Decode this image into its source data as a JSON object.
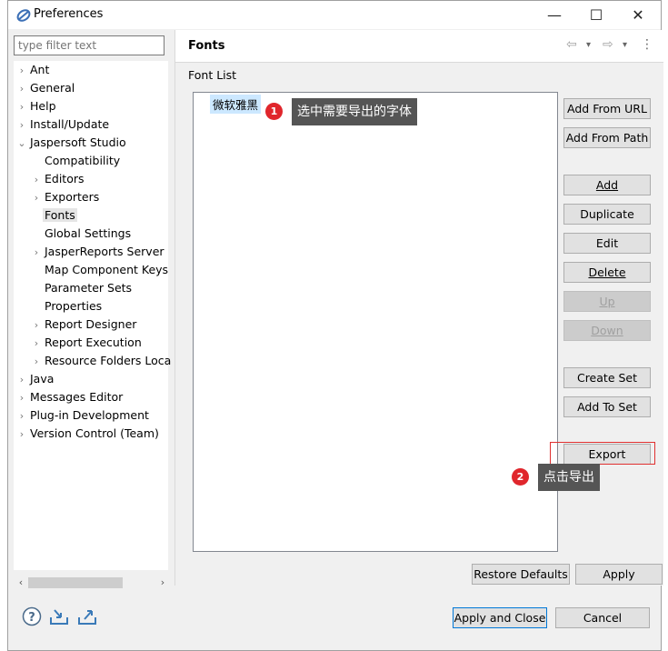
{
  "window": {
    "title": "Preferences",
    "controls": {
      "minimize": "—",
      "maximize": "☐",
      "close": "✕"
    }
  },
  "sidebar": {
    "filter_placeholder": "type filter text",
    "items": [
      {
        "label": "Ant",
        "level": 0,
        "expander": "›"
      },
      {
        "label": "General",
        "level": 0,
        "expander": "›"
      },
      {
        "label": "Help",
        "level": 0,
        "expander": "›"
      },
      {
        "label": "Install/Update",
        "level": 0,
        "expander": "›"
      },
      {
        "label": "Jaspersoft Studio",
        "level": 0,
        "expander": "⌄"
      },
      {
        "label": "Compatibility",
        "level": 1,
        "expander": ""
      },
      {
        "label": "Editors",
        "level": 1,
        "expander": "›"
      },
      {
        "label": "Exporters",
        "level": 1,
        "expander": "›"
      },
      {
        "label": "Fonts",
        "level": 1,
        "expander": "",
        "selected": true
      },
      {
        "label": "Global Settings",
        "level": 1,
        "expander": ""
      },
      {
        "label": "JasperReports Server",
        "level": 1,
        "expander": "›"
      },
      {
        "label": "Map Component Keys",
        "level": 1,
        "expander": ""
      },
      {
        "label": "Parameter Sets",
        "level": 1,
        "expander": ""
      },
      {
        "label": "Properties",
        "level": 1,
        "expander": ""
      },
      {
        "label": "Report Designer",
        "level": 1,
        "expander": "›"
      },
      {
        "label": "Report Execution",
        "level": 1,
        "expander": "›"
      },
      {
        "label": "Resource Folders Loca",
        "level": 1,
        "expander": "›"
      },
      {
        "label": "Java",
        "level": 0,
        "expander": "›"
      },
      {
        "label": "Messages Editor",
        "level": 0,
        "expander": "›"
      },
      {
        "label": "Plug-in Development",
        "level": 0,
        "expander": "›"
      },
      {
        "label": "Version Control (Team)",
        "level": 0,
        "expander": "›"
      }
    ],
    "scroll_left": "‹",
    "scroll_right": "›"
  },
  "page": {
    "title": "Fonts",
    "nav": {
      "back": "⇦",
      "back_menu": "▾",
      "forward": "⇨",
      "forward_menu": "▾",
      "more": "⋮"
    },
    "font_list_label": "Font List",
    "fonts": [
      "微软雅黑"
    ],
    "buttons": {
      "add_from_url": "Add From URL",
      "add_from_path": "Add From Path",
      "add": "Add",
      "duplicate": "Duplicate",
      "edit": "Edit",
      "delete": "Delete",
      "up": "Up",
      "down": "Down",
      "create_set": "Create Set",
      "add_to_set": "Add To Set",
      "export": "Export",
      "restore_defaults": "Restore Defaults",
      "apply": "Apply"
    }
  },
  "annotations": [
    {
      "number": "1",
      "text": "选中需要导出的字体"
    },
    {
      "number": "2",
      "text": "点击导出"
    }
  ],
  "footer": {
    "apply_and_close": "Apply and Close",
    "cancel": "Cancel",
    "help_icon": "?",
    "import_icon": "import-icon",
    "export_icon": "export-icon"
  },
  "colors": {
    "selection": "#cce8ff",
    "callout": "#555555",
    "badge": "#e0262c",
    "highlight": "#e03030"
  }
}
